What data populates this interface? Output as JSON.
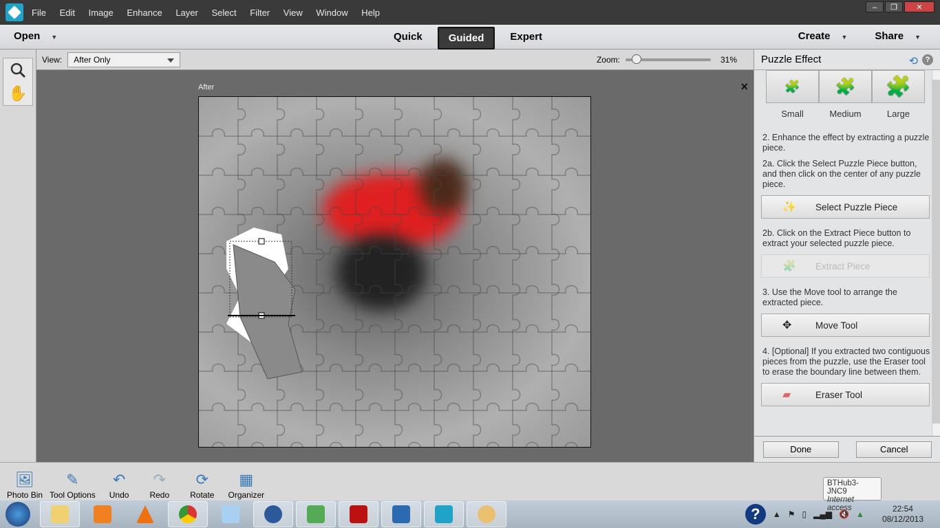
{
  "menubar": {
    "items": [
      "File",
      "Edit",
      "Image",
      "Enhance",
      "Layer",
      "Select",
      "Filter",
      "View",
      "Window",
      "Help"
    ],
    "window_controls": [
      "–",
      "❐",
      "✕"
    ]
  },
  "modebar": {
    "open": "Open",
    "modes": [
      "Quick",
      "Guided",
      "Expert"
    ],
    "active_mode": "Guided",
    "create": "Create",
    "share": "Share"
  },
  "options": {
    "view_label": "View:",
    "view_value": "After Only",
    "zoom_label": "Zoom:",
    "zoom_value": "31%",
    "zoom_percent": 31
  },
  "canvas": {
    "label": "After",
    "close": "×"
  },
  "panel": {
    "title": "Puzzle Effect",
    "sizes": [
      "Small",
      "Medium",
      "Large"
    ],
    "step2": "2. Enhance the effect by extracting a puzzle piece.",
    "step2a": "2a. Click the Select Puzzle Piece button, and then click on the center of any puzzle piece.",
    "select_btn": "Select Puzzle Piece",
    "step2b": "2b. Click on the Extract Piece button to extract your selected puzzle piece.",
    "extract_btn": "Extract Piece",
    "step3": "3. Use the Move tool to arrange the extracted piece.",
    "move_btn": "Move Tool",
    "step4": "4. [Optional] If you extracted two contiguous pieces from the puzzle, use the Eraser tool to erase the boundary line between them.",
    "eraser_btn": "Eraser Tool",
    "done": "Done",
    "cancel": "Cancel"
  },
  "bottombar": {
    "items": [
      "Photo Bin",
      "Tool Options",
      "Undo",
      "Redo",
      "Rotate",
      "Organizer"
    ]
  },
  "tooltip": {
    "network": "BTHub3-JNC9",
    "status": "Internet access"
  },
  "taskbar": {
    "time": "22:54",
    "date": "08/12/2013"
  }
}
